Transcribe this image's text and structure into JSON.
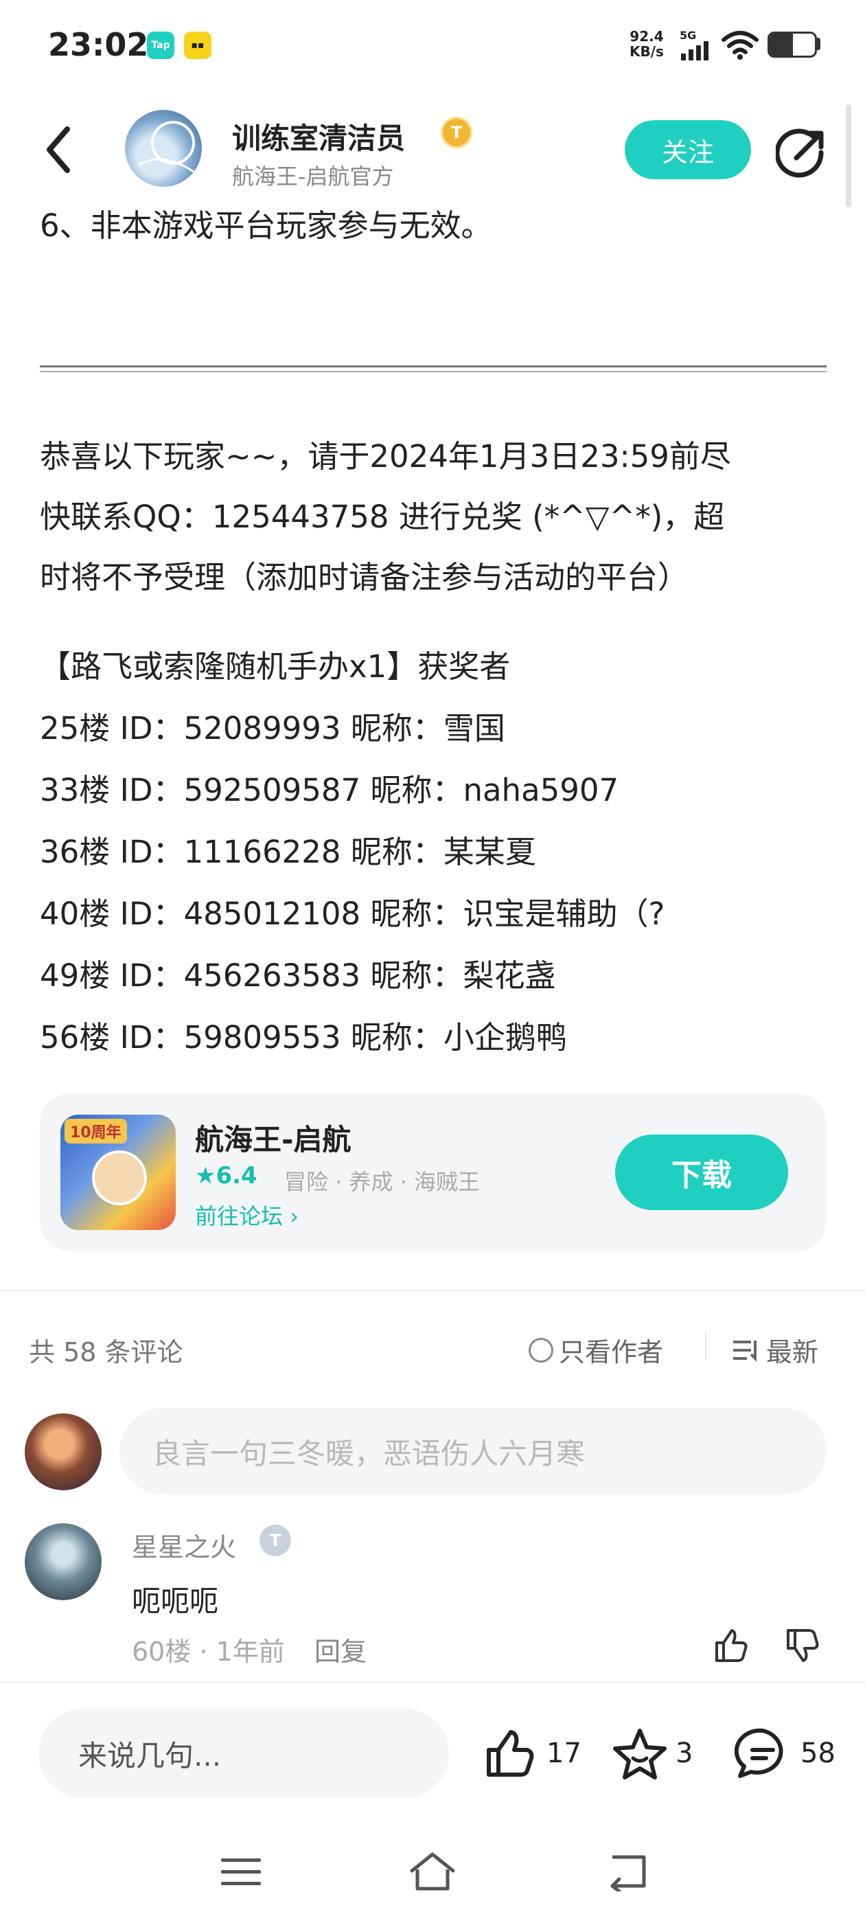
{
  "status_bar": {
    "time": "23:02",
    "app_icons": [
      {
        "label": "Tap",
        "bg": "#1fcfbf",
        "fg": "#ffffff"
      },
      {
        "label": "▪▪",
        "bg": "#f8d31c",
        "fg": "#222222"
      }
    ],
    "net_speed_value": "92.4",
    "net_speed_unit": "KB/s",
    "network": "5G",
    "battery_level": 0.52
  },
  "header": {
    "author_name": "训练室清洁员",
    "level_badge": "T",
    "author_subtitle": "航海王-启航官方",
    "follow_label": "关注"
  },
  "article": {
    "lines": [
      "6、非本游戏平台玩家参与无效。",
      "恭喜以下玩家~~，请于2024年1月3日23:59前尽",
      "快联系QQ：125443758 进行兑奖 (*^▽^*)，超",
      "时将不予受理（添加时请备注参与活动的平台）",
      "【路飞或索隆随机手办x1】获奖者",
      "25楼  ID：52089993  昵称：雪国",
      "33楼  ID：592509587  昵称：naha5907",
      "36楼  ID：11166228  昵称：某某夏",
      "40楼  ID：485012108  昵称：识宝是辅助（?",
      "49楼  ID：456263583  昵称：梨花盏",
      "56楼  ID：59809553  昵称：小企鹅鸭"
    ]
  },
  "game_card": {
    "icon_badge": "10周年",
    "name": "航海王-启航",
    "rating": "6.4",
    "tags": "冒险 · 养成 · 海贼王",
    "forum_link": "前往论坛",
    "download_label": "下载"
  },
  "comments_header": {
    "count_label": "共 58 条评论",
    "author_only_label": "只看作者",
    "sort_label": "最新"
  },
  "comment_input": {
    "placeholder": "良言一句三冬暖，恶语伤人六月寒"
  },
  "comments": [
    {
      "user": "星星之火",
      "level_badge": "T",
      "text": "呃呃呃",
      "meta": "60楼 · 1年前",
      "reply_label": "回复"
    }
  ],
  "bottom_bar": {
    "say_placeholder": "来说几句...",
    "likes": "17",
    "favorites": "3",
    "comments": "58"
  },
  "colors": {
    "accent": "#1fcfbf",
    "accent_text": "#14bfae",
    "badge_gold": "#f3b632"
  }
}
